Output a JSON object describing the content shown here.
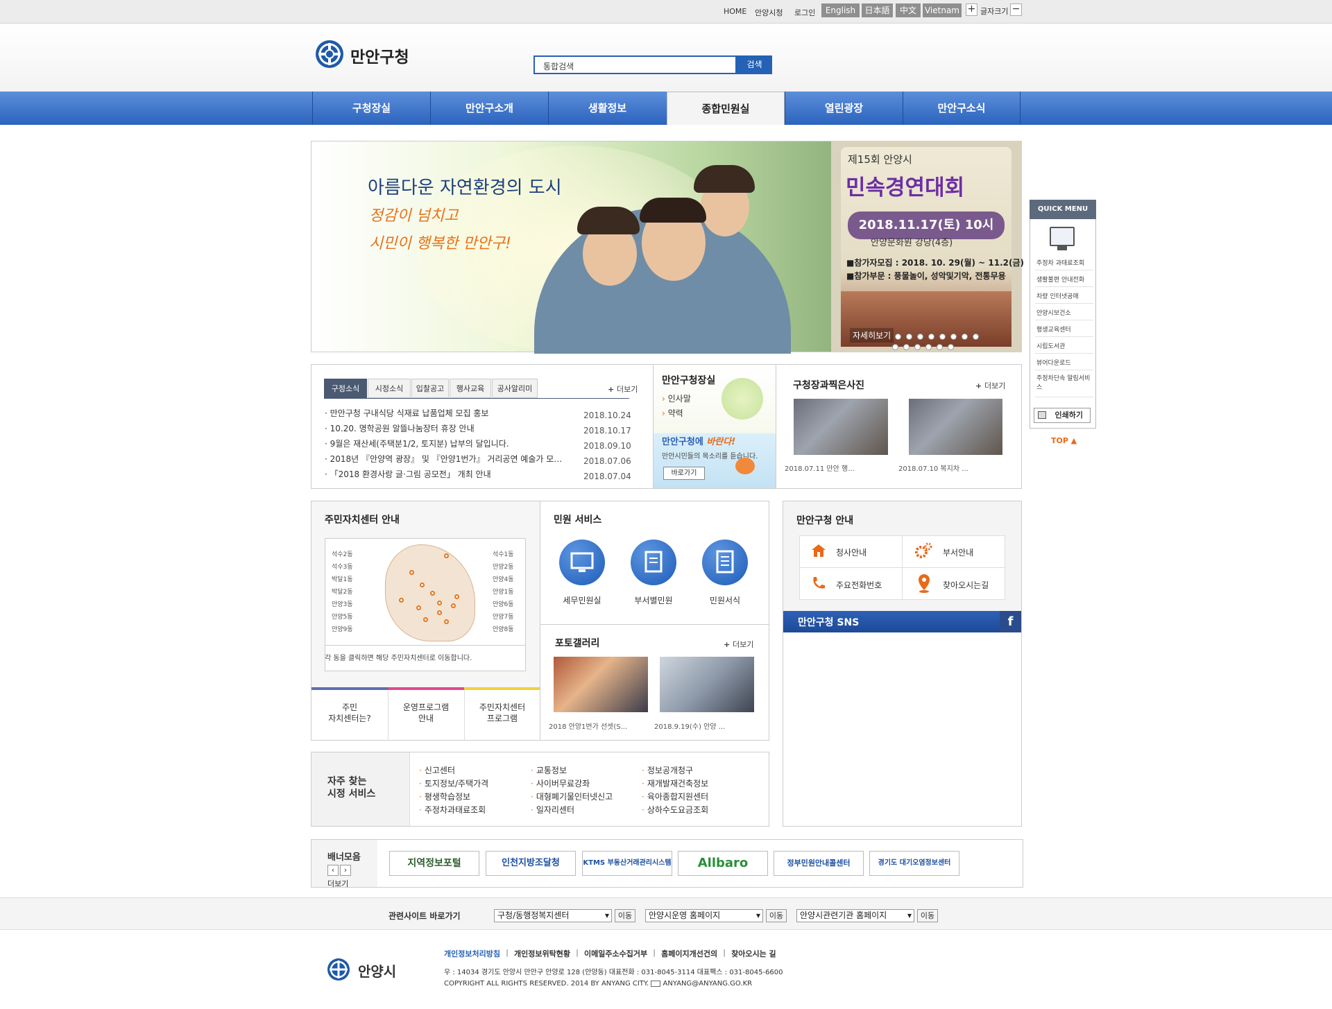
{
  "topbar": {
    "links": [
      "HOME",
      "안양시청",
      "로그인"
    ],
    "languages": [
      "English",
      "日本語",
      "中文",
      "Vietnam"
    ],
    "font_size_label": "글자크기",
    "plus": "+",
    "minus": "−"
  },
  "header": {
    "logo_text": "만안구청",
    "search_placeholder": "통합검색",
    "search_button": "검색"
  },
  "nav": {
    "items": [
      "구청장실",
      "만안구소개",
      "생활정보",
      "종합민원실",
      "열린광장",
      "만안구소식"
    ],
    "active": "종합민원실"
  },
  "hero": {
    "title": "아름다운 자연환경의 도시",
    "subtitle_line1": "정감이 넘치고",
    "subtitle_line2": "시민이 행복한 만안구!"
  },
  "poster": {
    "line1": "제15회 안양시",
    "line2": "민속경연대회",
    "date": "2018.11.17(토) 10시",
    "venue": "안양문화원 강당(4층)",
    "recruit": "■참가자모집 : 2018. 10. 29(월) ~ 11.2(금)",
    "category": "■참가부문 : 풍물놀이, 성악및기악, 전통무용",
    "more": "자세히보기"
  },
  "notice": {
    "tabs": [
      "구정소식",
      "시정소식",
      "입찰공고",
      "행사교육",
      "공사알리미"
    ],
    "more": "더보기",
    "items": [
      {
        "title": "만안구청 구내식당 식재료 납품업체 모집 홍보",
        "date": "2018.10.24"
      },
      {
        "title": "10.20. 명학공원 알뜰나눔장터 휴장 안내",
        "date": "2018.10.17"
      },
      {
        "title": "9월은 재산세(주택분1/2, 토지분) 납부의 달입니다.",
        "date": "2018.09.10"
      },
      {
        "title": "2018년 『안양역 광장』 및 『안양1번가』 거리공연 예술가 모…",
        "date": "2018.07.06"
      },
      {
        "title": "「2018 환경사랑 글·그림 공모전」 개최 안내",
        "date": "2018.07.04"
      }
    ]
  },
  "mayor": {
    "title": "만안구청장실",
    "links": [
      "인사말",
      "약력"
    ],
    "promo_title_a": "만안구청에 ",
    "promo_title_b": "바란다!",
    "promo_desc": "만안시민들의 목소리를 듣습니다.",
    "promo_button": "바로가기"
  },
  "photos": {
    "title": "구청장과찍은사진",
    "more": "더보기",
    "items": [
      "2018.07.11 만안 행...",
      "2018.07.10 복지차 ..."
    ]
  },
  "centers": {
    "title": "주민자치센터 안내",
    "left_labels": [
      "석수2동",
      "석수3동",
      "박달1동",
      "박달2동",
      "안양3동",
      "안양5동",
      "안양9동"
    ],
    "right_labels": [
      "석수1동",
      "안양2동",
      "안양4동",
      "안양1동",
      "안양6동",
      "안양7동",
      "안양8동"
    ],
    "note": "각 동을 클릭하면 해당 주민자치센터로 이동합니다.",
    "tabs": [
      {
        "line1": "주민",
        "line2": "자치센터는?"
      },
      {
        "line1": "운영프로그램",
        "line2": "안내"
      },
      {
        "line1": "주민자치센터",
        "line2": "프로그램"
      }
    ]
  },
  "services": {
    "title": "민원 서비스",
    "items": [
      "세무민원실",
      "부서별민원",
      "민원서식"
    ]
  },
  "gallery": {
    "title": "포토갤러리",
    "more": "더보기",
    "items": [
      "2018 안양1번가 선셋(S...",
      "2018.9.19(수) 안양 ..."
    ]
  },
  "office_guide": {
    "title": "만안구청 안내",
    "items": [
      "청사안내",
      "부서안내",
      "주요전화번호",
      "찾아오시는길"
    ]
  },
  "sns": {
    "title": "만안구청 SNS"
  },
  "frequent": {
    "title_line1": "자주 찾는",
    "title_line2": "시정 서비스",
    "columns": [
      [
        "신고센터",
        "토지정보/주택가격",
        "평생학습정보",
        "주정차과태료조회"
      ],
      [
        "교통정보",
        "사이버무료강좌",
        "대형폐기물인터넷신고",
        "일자리센터"
      ],
      [
        "정보공개청구",
        "재개발재건축정보",
        "육아종합지원센터",
        "상하수도요금조회"
      ]
    ]
  },
  "banners": {
    "title": "배너모음",
    "more": "더보기",
    "prev": "‹",
    "next": "›",
    "items": [
      "지역정보포털",
      "인천지방조달청",
      "KTMS 부동산거래관리시스템",
      "Allbaro",
      "정부민원안내콜센터",
      "경기도 대기오염정보센터"
    ]
  },
  "related": {
    "title": "관련사이트 바로가기",
    "selects": [
      "구청/동행정복지센터",
      "안양시운영 홈페이지",
      "안양시관련기관 홈페이지"
    ],
    "go": "이동"
  },
  "quick": {
    "title": "QUICK MENU",
    "items": [
      "주정차 과태료조회",
      "생활불편 안내전화",
      "차량 인터넷공매",
      "안양시보건소",
      "평생교육센터",
      "시립도서관",
      "뷰어다운로드",
      "주정차단속 알림서비스"
    ],
    "print": "인쇄하기",
    "top": "TOP ▲"
  },
  "footer": {
    "logo": "안양시",
    "links": [
      "개인정보처리방침",
      "개인정보위탁현황",
      "이메일주소수집거부",
      "홈페이지개선건의",
      "찾아오시는 길"
    ],
    "address": "우 : 14034  경기도 안양시 만안구 안양로 128 (안양동) 대표전화 : 031-8045-3114 대표팩스 : 031-8045-6600",
    "copyright": "COPYRIGHT ALL RIGHTS RESERVED. 2014 BY ANYANG CITY.",
    "email": "ANYANG@ANYANG.GO.KR"
  },
  "colors": {
    "brand_blue": "#2561b5",
    "accent_orange": "#e86a1a",
    "nav_active_bg": "#f4f4f4"
  }
}
